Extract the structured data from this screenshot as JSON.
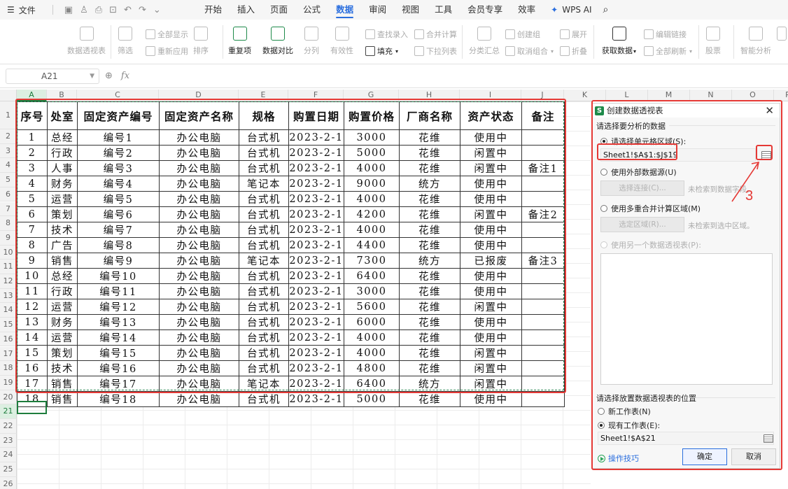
{
  "menubar": {
    "file_label": "文件",
    "tabs": [
      "开始",
      "插入",
      "页面",
      "公式",
      "数据",
      "审阅",
      "视图",
      "工具",
      "会员专享",
      "效率"
    ],
    "active_tab": "数据",
    "wps_ai": "WPS AI"
  },
  "ribbon": {
    "pivot": "数据透视表",
    "filter": "筛选",
    "show_all": "全部显示",
    "reapply": "重新应用",
    "sort": "排序",
    "duplicates": "重复项",
    "compare": "数据对比",
    "split": "分列",
    "validity": "有效性",
    "fill": "填充",
    "lookup_entry": "查找录入",
    "dropdown_list": "下拉列表",
    "consolidate": "合并计算",
    "subtotal": "分类汇总",
    "group": "创建组",
    "ungroup": "取消组合",
    "expand": "展开",
    "collapse": "折叠",
    "get_data": "获取数据",
    "edit_links": "编辑链接",
    "refresh_all": "全部刷新",
    "stocks": "股票",
    "smart_analysis": "智能分析"
  },
  "formula_bar": {
    "name_box": "A21",
    "fx": "fx",
    "value": ""
  },
  "sheet": {
    "columns": [
      "A",
      "B",
      "C",
      "D",
      "E",
      "F",
      "G",
      "H",
      "I",
      "J",
      "K",
      "L",
      "M",
      "N",
      "O",
      "P"
    ],
    "headers": [
      "序号",
      "处室",
      "固定资产编号",
      "固定资产名称",
      "规格",
      "购置日期",
      "购置价格",
      "厂商名称",
      "资产状态",
      "备注"
    ],
    "rows": [
      [
        "1",
        "总经",
        "编号1",
        "办公电脑",
        "台式机",
        "2023-2-1",
        "3000",
        "花维",
        "使用中",
        ""
      ],
      [
        "2",
        "行政",
        "编号2",
        "办公电脑",
        "台式机",
        "2023-2-1",
        "5000",
        "花维",
        "闲置中",
        ""
      ],
      [
        "3",
        "人事",
        "编号3",
        "办公电脑",
        "台式机",
        "2023-2-1",
        "4000",
        "花维",
        "闲置中",
        "备注1"
      ],
      [
        "4",
        "财务",
        "编号4",
        "办公电脑",
        "笔记本",
        "2023-2-1",
        "9000",
        "统方",
        "使用中",
        ""
      ],
      [
        "5",
        "运营",
        "编号5",
        "办公电脑",
        "台式机",
        "2023-2-1",
        "4000",
        "花维",
        "使用中",
        ""
      ],
      [
        "6",
        "策划",
        "编号6",
        "办公电脑",
        "台式机",
        "2023-2-1",
        "4200",
        "花维",
        "闲置中",
        "备注2"
      ],
      [
        "7",
        "技术",
        "编号7",
        "办公电脑",
        "台式机",
        "2023-2-1",
        "4000",
        "花维",
        "使用中",
        ""
      ],
      [
        "8",
        "广告",
        "编号8",
        "办公电脑",
        "台式机",
        "2023-2-1",
        "4400",
        "花维",
        "使用中",
        ""
      ],
      [
        "9",
        "销售",
        "编号9",
        "办公电脑",
        "笔记本",
        "2023-2-1",
        "7300",
        "统方",
        "已报废",
        "备注3"
      ],
      [
        "10",
        "总经",
        "编号10",
        "办公电脑",
        "台式机",
        "2023-2-1",
        "6400",
        "花维",
        "使用中",
        ""
      ],
      [
        "11",
        "行政",
        "编号11",
        "办公电脑",
        "台式机",
        "2023-2-1",
        "3000",
        "花维",
        "使用中",
        ""
      ],
      [
        "12",
        "运营",
        "编号12",
        "办公电脑",
        "台式机",
        "2023-2-1",
        "5600",
        "花维",
        "闲置中",
        ""
      ],
      [
        "13",
        "财务",
        "编号13",
        "办公电脑",
        "台式机",
        "2023-2-1",
        "6000",
        "花维",
        "使用中",
        ""
      ],
      [
        "14",
        "运营",
        "编号14",
        "办公电脑",
        "台式机",
        "2023-2-1",
        "4000",
        "花维",
        "使用中",
        ""
      ],
      [
        "15",
        "策划",
        "编号15",
        "办公电脑",
        "台式机",
        "2023-2-1",
        "4000",
        "花维",
        "闲置中",
        ""
      ],
      [
        "16",
        "技术",
        "编号16",
        "办公电脑",
        "台式机",
        "2023-2-1",
        "4800",
        "花维",
        "闲置中",
        ""
      ],
      [
        "17",
        "销售",
        "编号17",
        "办公电脑",
        "笔记本",
        "2023-2-1",
        "6400",
        "统方",
        "闲置中",
        ""
      ],
      [
        "18",
        "销售",
        "编号18",
        "办公电脑",
        "台式机",
        "2023-2-1",
        "5000",
        "花维",
        "使用中",
        ""
      ]
    ]
  },
  "dialog": {
    "title": "创建数据透视表",
    "section_data": "请选择要分析的数据",
    "opt_range": "请选择单元格区域(S):",
    "range_value": "Sheet1!$A$1:$J$19",
    "opt_external": "使用外部数据源(U)",
    "btn_select_conn": "选择连接(C)...",
    "hint_no_fields": "未检索到数据字段。",
    "opt_multi": "使用多重合并计算区域(M)",
    "btn_select_region": "选定区域(R)...",
    "hint_no_region": "未检索到选中区域。",
    "opt_other_pivot": "使用另一个数据透视表(P):",
    "section_place": "请选择放置数据透视表的位置",
    "opt_new_sheet": "新工作表(N)",
    "opt_existing": "现有工作表(E):",
    "location_value": "Sheet1!$A$21",
    "tips": "操作技巧",
    "ok": "确定",
    "cancel": "取消"
  },
  "annotation": {
    "step": "3"
  },
  "colors": {
    "accent": "#2a6ede",
    "sheet_green": "#1e7d3d",
    "annotation_red": "#e53935"
  }
}
